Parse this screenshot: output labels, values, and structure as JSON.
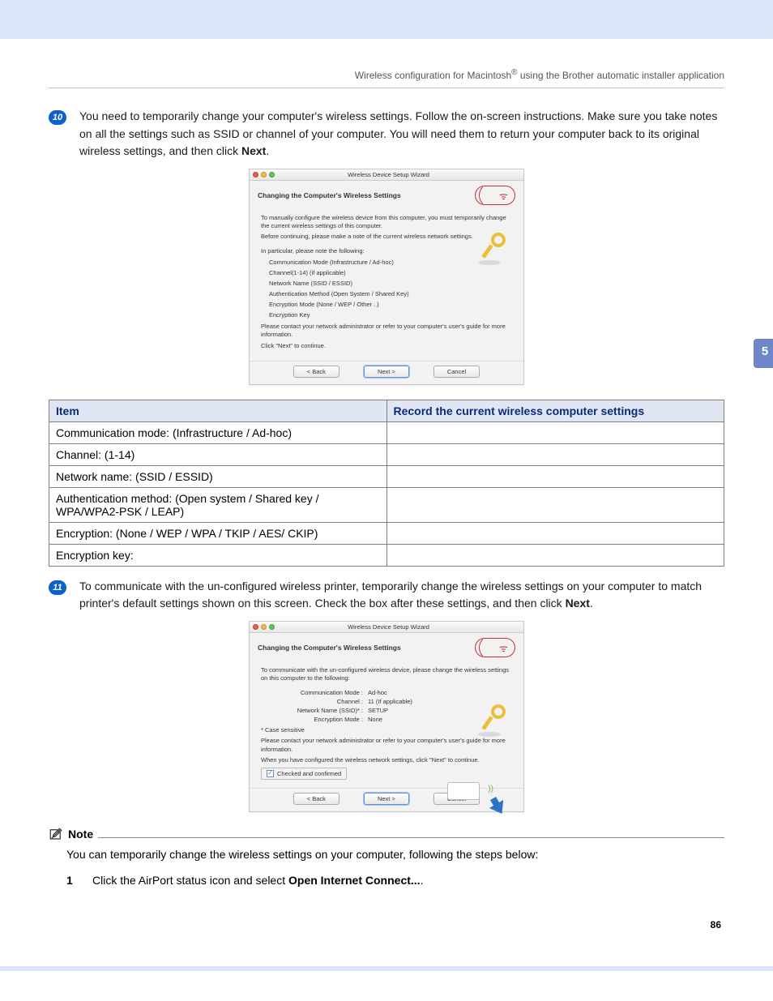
{
  "header": "Wireless configuration for Macintosh® using the Brother automatic installer application",
  "section_tab": "5",
  "step10": {
    "num": "10",
    "text_a": "You need to temporarily change your computer's wireless settings. Follow the on-screen instructions. Make sure you take notes on all the settings such as SSID or channel of your computer. You will need them to return your computer back to its original wireless settings, and then click ",
    "text_b": "Next",
    "text_c": "."
  },
  "dialog1": {
    "title": "Wireless Device Setup Wizard",
    "heading": "Changing the Computer's Wireless Settings",
    "l1": "To manually configure the wireless device from this computer, you must temporarily change the current wireless settings of this computer.",
    "l2": "Before continuing, please make a note of the current wireless network settings.",
    "l3": "In particular, please note the following:",
    "b1": "Communication Mode (Infrastructure / Ad-hoc)",
    "b2": "Channel(1-14) (if applicable)",
    "b3": "Network Name (SSID / ESSID)",
    "b4": "Authentication Method (Open System / Shared Key)",
    "b5": "Encryption Mode (None / WEP / Other ..)",
    "b6": "Encryption Key",
    "l4": "Please contact your network administrator or refer to your computer's user's guide for more information.",
    "l5": "Click \"Next\" to continue.",
    "back": "< Back",
    "next": "Next >",
    "cancel": "Cancel"
  },
  "table": {
    "h1": "Item",
    "h2": "Record the current wireless computer settings",
    "rows": [
      "Communication mode: (Infrastructure / Ad-hoc)",
      "Channel: (1-14)",
      "Network name: (SSID / ESSID)",
      "Authentication method: (Open system / Shared key / WPA/WPA2-PSK / LEAP)",
      "Encryption: (None / WEP / WPA / TKIP / AES/ CKIP)",
      "Encryption key:"
    ]
  },
  "step11": {
    "num": "11",
    "text_a": "To communicate with the un-configured wireless printer, temporarily change the wireless settings on your computer to match printer's default settings shown on this screen. Check the box after these settings, and then click ",
    "text_b": "Next",
    "text_c": "."
  },
  "dialog2": {
    "title": "Wireless Device Setup Wizard",
    "heading": "Changing the Computer's Wireless Settings",
    "l1": "To communicate with the un-configured wireless device, please change the wireless settings on this computer to the following:",
    "kv": [
      {
        "k": "Communication Mode :",
        "v": "Ad-hoc"
      },
      {
        "k": "Channel :",
        "v": "11  (If applicable)"
      },
      {
        "k": "Network Name (SSID)* :",
        "v": "SETUP"
      },
      {
        "k": "Encryption Mode :",
        "v": "None"
      }
    ],
    "note": "* Case sensitive",
    "l2": "Please contact your network administrator or refer to your computer's user's guide for more information.",
    "l3": "When you have configured the wireless network settings, click \"Next\" to continue.",
    "chk": "Checked and confirmed",
    "back": "< Back",
    "next": "Next >",
    "cancel": "Cancel"
  },
  "note": {
    "title": "Note",
    "body": "You can temporarily change the wireless settings on your computer, following the steps below:",
    "step1_num": "1",
    "step1_a": "Click the AirPort status icon and select ",
    "step1_b": "Open Internet Connect...",
    "step1_c": "."
  },
  "page_number": "86"
}
